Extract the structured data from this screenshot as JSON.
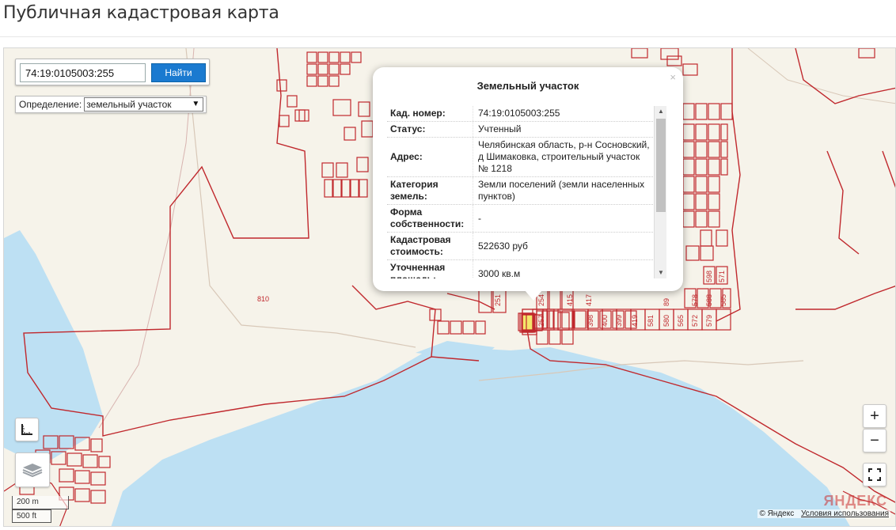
{
  "page": {
    "title": "Публичная кадастровая карта"
  },
  "search": {
    "value": "74:19:0105003:255",
    "button_label": "Найти"
  },
  "definition": {
    "label": "Определение:",
    "selected": "земельный участок"
  },
  "popup": {
    "title": "Земельный участок",
    "close": "×",
    "rows": [
      {
        "key": "Кад. номер:",
        "value": "74:19:0105003:255"
      },
      {
        "key": "Статус:",
        "value": "Учтенный"
      },
      {
        "key": "Адрес:",
        "value": "Челябинская область, р-н Сосновский, д Шимаковка, строительный участок № 1218"
      },
      {
        "key": "Категория земель:",
        "value": "Земли поселений (земли населенных пунктов)"
      },
      {
        "key": "Форма собственности:",
        "value": "-"
      },
      {
        "key": "Кадастровая стоимость:",
        "value": "522630 руб"
      },
      {
        "key": "Уточненная площадь:",
        "value": "3000 кв.м"
      }
    ]
  },
  "map": {
    "area_label": "810",
    "plot_labels": [
      "251",
      "254",
      "257",
      "415",
      "417",
      "398",
      "400",
      "399",
      "419",
      "581",
      "580",
      "565",
      "572",
      "579",
      "89",
      "578",
      "588",
      "585",
      "598",
      "571"
    ]
  },
  "controls": {
    "zoom_in": "+",
    "zoom_out": "−"
  },
  "scale": {
    "metric": "200 m",
    "imperial": "500 ft"
  },
  "copyright": {
    "provider": "© Яндекс",
    "terms": "Условия использования",
    "watermark": "ЯНДЕКС"
  },
  "colors": {
    "water": "#bde0f3",
    "boundary": "#c0282d",
    "land": "#f6f3ea",
    "selected_plot": "#f4e66a",
    "button": "#1a7ad0"
  }
}
